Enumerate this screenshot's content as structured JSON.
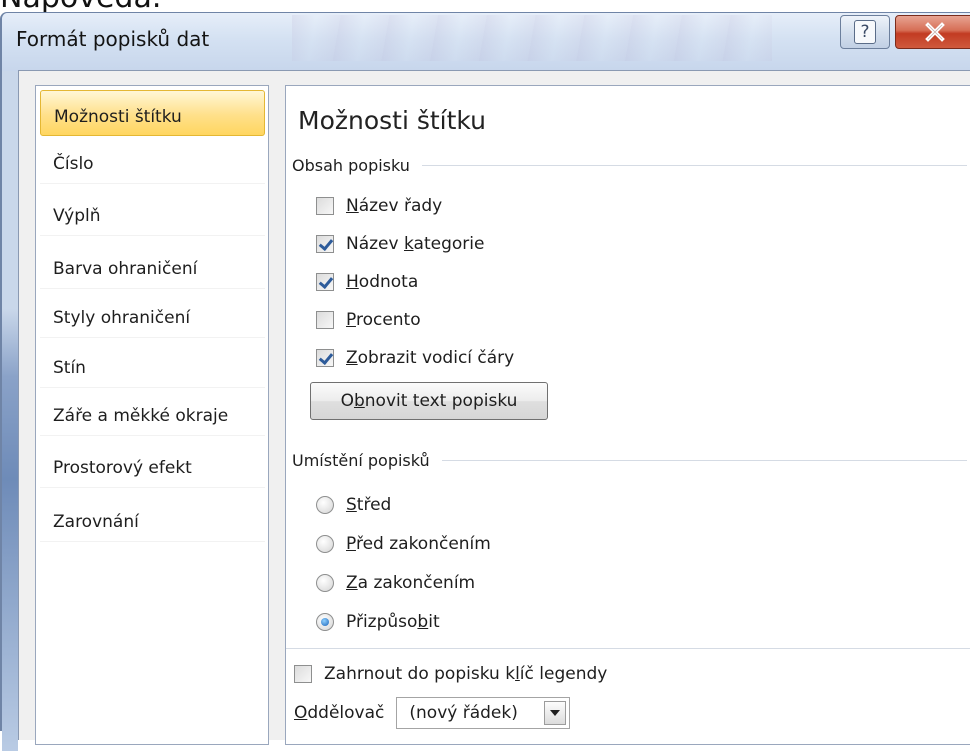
{
  "background_caption": "Nápověda.",
  "window": {
    "title": "Formát popisků dat",
    "help_glyph": "?",
    "close_icon": "close-icon"
  },
  "nav": [
    {
      "label": "Možnosti štítku",
      "active": true
    },
    {
      "label": "Číslo"
    },
    {
      "label": "Výplň"
    },
    {
      "label": "Barva ohraničení"
    },
    {
      "label": "Styly ohraničení"
    },
    {
      "label": "Stín"
    },
    {
      "label": "Záře a měkké okraje"
    },
    {
      "label": "Prostorový efekt"
    },
    {
      "label": "Zarovnání"
    }
  ],
  "panel": {
    "title": "Možnosti štítku",
    "content_group": {
      "header": "Obsah popisku",
      "options": [
        {
          "key": "N",
          "rest": "ázev řady",
          "checked": false
        },
        {
          "pre": "Název ",
          "key": "k",
          "rest": "ategorie",
          "checked": true
        },
        {
          "key": "H",
          "rest": "odnota",
          "checked": true
        },
        {
          "key": "P",
          "rest": "rocento",
          "checked": false
        },
        {
          "key": "Z",
          "rest": "obrazit vodicí čáry",
          "checked": true
        }
      ],
      "reset_button": {
        "pre": "O",
        "key": "b",
        "rest": "novit text popisku"
      }
    },
    "position_group": {
      "header": "Umístění popisků",
      "options": [
        {
          "key": "S",
          "rest": "třed",
          "selected": false
        },
        {
          "key": "P",
          "rest": "řed zakončením",
          "selected": false
        },
        {
          "key": "Z",
          "rest": "a zakončením",
          "selected": false
        },
        {
          "pre": "Přizpůso",
          "key": "b",
          "rest": "it",
          "selected": true
        }
      ]
    },
    "legend_key": {
      "pre": "Zahrnout do popisku k",
      "key": "l",
      "rest": "íč legendy",
      "checked": false
    },
    "separator": {
      "label_key": "O",
      "label_rest": "ddělovač",
      "value": "(nový řádek)"
    }
  },
  "colors": {
    "title_bar": "#d4e1f2",
    "active_nav": "#ffe08a",
    "close_button": "#c23b22",
    "check_mark": "#2d5b9a",
    "radio_dot": "#1a63b8"
  }
}
